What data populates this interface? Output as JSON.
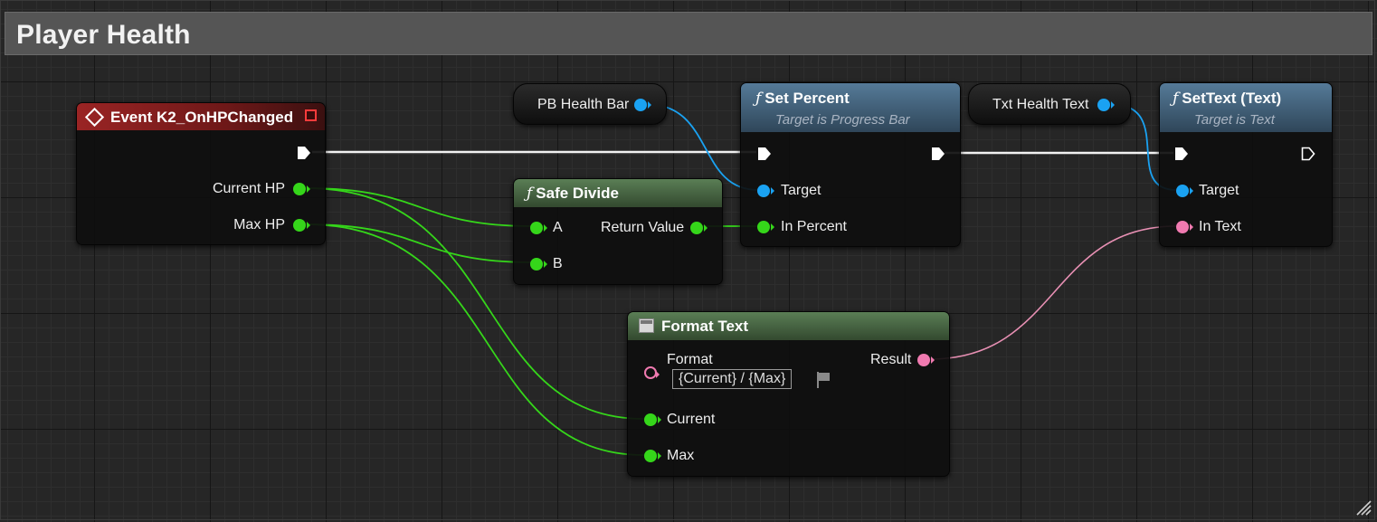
{
  "comment": {
    "title": "Player Health"
  },
  "nodes": {
    "event": {
      "title": "Event K2_OnHPChanged",
      "pins": {
        "current_hp": "Current HP",
        "max_hp": "Max HP"
      }
    },
    "safe_divide": {
      "title": "Safe Divide",
      "pins": {
        "a": "A",
        "b": "B",
        "return_value": "Return Value"
      }
    },
    "set_percent": {
      "title": "Set Percent",
      "subtitle": "Target is Progress Bar",
      "pins": {
        "target": "Target",
        "in_percent": "In Percent"
      }
    },
    "set_text": {
      "title": "SetText (Text)",
      "subtitle": "Target is Text",
      "pins": {
        "target": "Target",
        "in_text": "In Text"
      }
    },
    "format_text": {
      "title": "Format Text",
      "pins": {
        "format": "Format",
        "format_value": "{Current} / {Max}",
        "result": "Result",
        "current": "Current",
        "max": "Max"
      }
    },
    "pb_health_bar": {
      "label": "PB Health Bar"
    },
    "txt_health_text": {
      "label": "Txt Health Text"
    }
  },
  "colors": {
    "event_header": "#8b1e1e",
    "function_header": "#4a6e8c",
    "pure_header": "#4b6b47",
    "float_pin": "#35d61a",
    "object_pin": "#1aa2f2",
    "text_pin": "#f07ab0",
    "exec_wire": "#ffffff"
  },
  "icons": {
    "event": "event-diamond-icon",
    "function": "function-f-icon",
    "format_text": "format-text-icon",
    "flag": "localization-flag-icon",
    "resize": "resize-grip-icon"
  }
}
